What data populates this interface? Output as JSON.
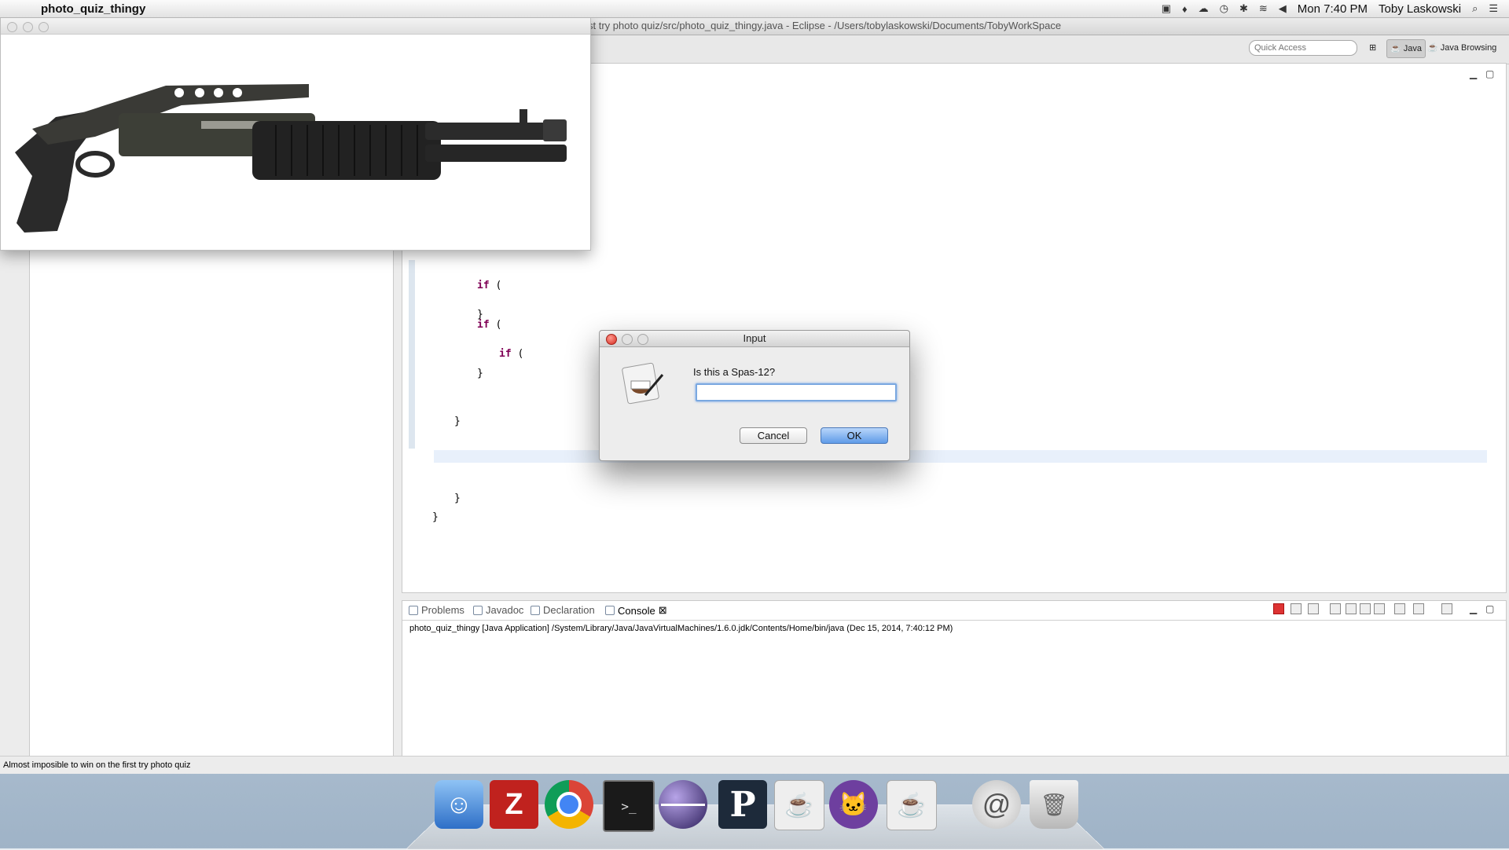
{
  "menubar": {
    "app_name": "photo_quiz_thingy",
    "clock": "Mon 7:40 PM",
    "user": "Toby Laskowski"
  },
  "eclipse": {
    "title": "st try photo quiz/src/photo_quiz_thingy.java - Eclipse - /Users/tobylaskowski/Documents/TobyWorkSpace",
    "quick_access_placeholder": "Quick Access",
    "perspectives": [
      "Java",
      "Java Browsing"
    ],
    "code_lines": [
      "if (",
      "}",
      "if (",
      "if (",
      "}",
      "}",
      "}",
      "}"
    ],
    "console_tabs": [
      "Problems",
      "Javadoc",
      "Declaration",
      "Console"
    ],
    "console_line": "photo_quiz_thingy [Java Application] /System/Library/Java/JavaVirtualMachines/1.6.0.jdk/Contents/Home/bin/java (Dec 15, 2014, 7:40:12 PM)",
    "status_text": "Almost imposible to win on the first try photo quiz"
  },
  "dialog": {
    "title": "Input",
    "prompt": "Is this a Spas-12?",
    "input_value": "",
    "cancel_label": "Cancel",
    "ok_label": "OK"
  },
  "dock": {
    "items": [
      "finder-icon",
      "filezilla-icon",
      "chrome-icon",
      "terminal-icon",
      "eclipse-icon",
      "p-app-icon",
      "java-icon",
      "github-icon",
      "java-icon",
      "mail-icon",
      "trash-icon"
    ]
  }
}
